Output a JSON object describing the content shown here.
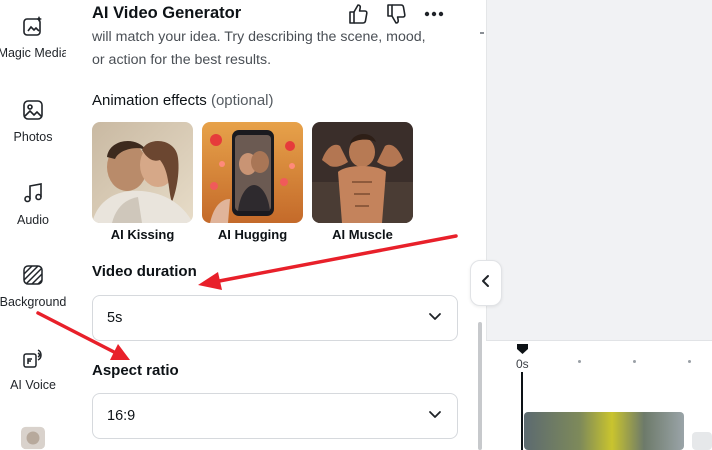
{
  "rail": {
    "items": [
      {
        "label": "Magic Media",
        "icon": "magic-media-icon"
      },
      {
        "label": "Photos",
        "icon": "photos-icon"
      },
      {
        "label": "Audio",
        "icon": "audio-icon"
      },
      {
        "label": "Background",
        "icon": "background-icon"
      },
      {
        "label": "AI Voice",
        "icon": "ai-voice-icon"
      },
      {
        "label": "",
        "icon": "avatar-app-icon"
      }
    ]
  },
  "panel": {
    "title": "AI Video Generator",
    "description": "will match your idea. Try describing the scene, mood, or action for the best results.",
    "animation_label": "Animation effects",
    "animation_optional": "(optional)",
    "effects": [
      {
        "label": "AI Kissing"
      },
      {
        "label": "AI Hugging"
      },
      {
        "label": "AI Muscle"
      }
    ],
    "duration_label": "Video duration",
    "duration_value": "5s",
    "aspect_label": "Aspect ratio",
    "aspect_value": "16:9"
  },
  "timeline": {
    "time_label": "0s"
  },
  "colors": {
    "arrow": "#e8202a",
    "text": "#0d1216"
  }
}
